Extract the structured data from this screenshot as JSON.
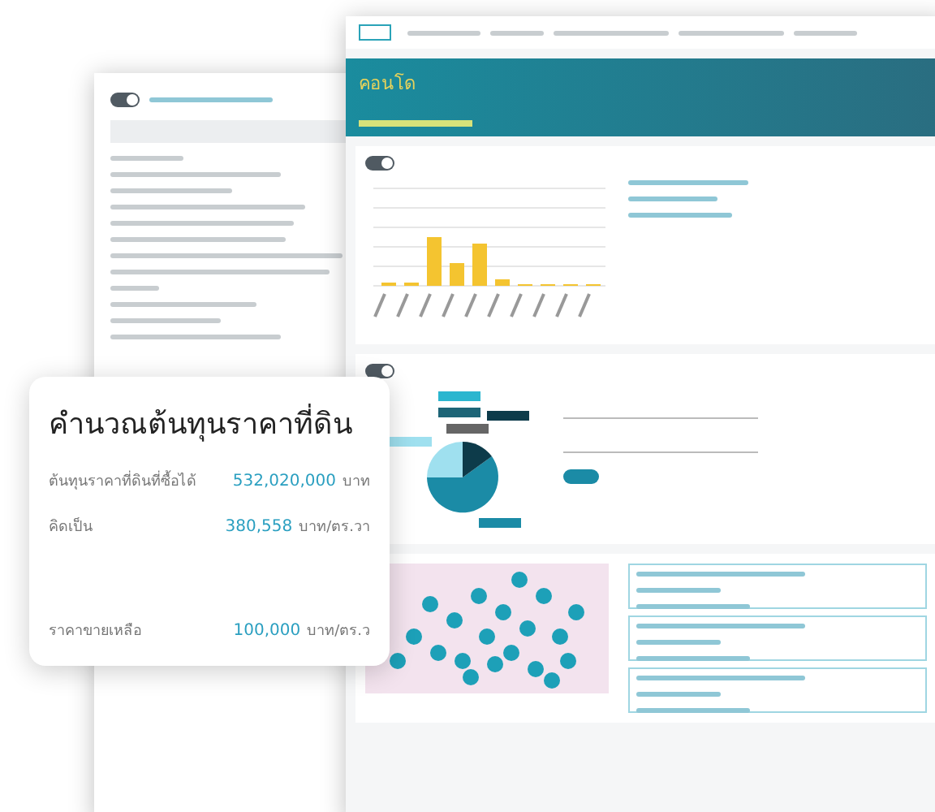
{
  "back_window": {
    "toggle": {
      "on": true
    }
  },
  "main_window": {
    "banner_title": "คอนโด",
    "toggles": [
      {
        "on": true
      },
      {
        "on": true
      }
    ]
  },
  "cost_card": {
    "title": "คำนวณต้นทุนราคาที่ดิน",
    "rows": [
      {
        "label": "ต้นทุนราคาที่ดินที่ซื้อได้",
        "value": "532,020,000",
        "unit": "บาท"
      },
      {
        "label": "คิดเป็น",
        "value": "380,558",
        "unit": "บาท/ตร.วา"
      },
      {
        "label": "ราคาขายเหลือ",
        "value": "100,000",
        "unit": "บาท/ตร.ว"
      }
    ]
  }
}
